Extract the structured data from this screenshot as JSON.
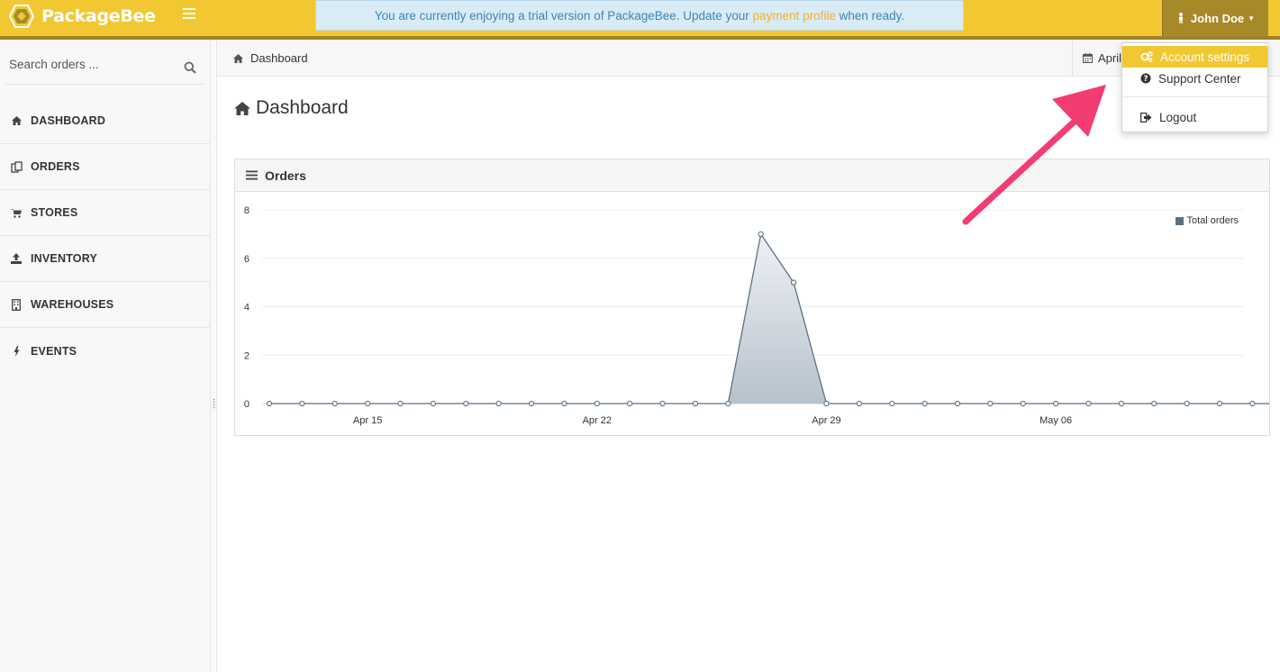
{
  "app": {
    "name": "PackageBee",
    "brand_color": "#f2c832"
  },
  "trial_banner": {
    "text_before": "You are currently enjoying a trial version of PackageBee. Update your ",
    "link": "payment profile",
    "text_after": " when ready."
  },
  "user_menu": {
    "name": "John Doe",
    "items": [
      {
        "label": "Account settings",
        "icon": "gears-icon",
        "active": true
      },
      {
        "label": "Support Center",
        "icon": "question-icon",
        "active": false
      },
      {
        "label": "Logout",
        "icon": "logout-icon",
        "active": false
      }
    ]
  },
  "sidebar": {
    "search_placeholder": "Search orders ...",
    "items": [
      {
        "label": "DASHBOARD",
        "icon": "home-icon"
      },
      {
        "label": "ORDERS",
        "icon": "copy-icon"
      },
      {
        "label": "STORES",
        "icon": "cart-icon"
      },
      {
        "label": "INVENTORY",
        "icon": "upload-icon"
      },
      {
        "label": "WAREHOUSES",
        "icon": "building-icon"
      },
      {
        "label": "EVENTS",
        "icon": "bolt-icon"
      }
    ]
  },
  "breadcrumb": {
    "label": "Dashboard",
    "date_label": "April"
  },
  "page": {
    "title": "Dashboard"
  },
  "orders_panel": {
    "title": "Orders"
  },
  "chart_data": {
    "type": "area",
    "title": "",
    "xlabel": "",
    "ylabel": "",
    "ylim": [
      0,
      8
    ],
    "yticks": [
      0,
      2,
      4,
      6,
      8
    ],
    "x_start": "Apr 12",
    "x_end": "May 13",
    "xtick_labels": [
      "Apr 15",
      "Apr 22",
      "Apr 29",
      "May 06"
    ],
    "grid": true,
    "legend_position": "top-right",
    "series": [
      {
        "name": "Total orders",
        "color": "#5b7085",
        "x": [
          "Apr 12",
          "Apr 13",
          "Apr 14",
          "Apr 15",
          "Apr 16",
          "Apr 17",
          "Apr 18",
          "Apr 19",
          "Apr 20",
          "Apr 21",
          "Apr 22",
          "Apr 23",
          "Apr 24",
          "Apr 25",
          "Apr 26",
          "Apr 27",
          "Apr 28",
          "Apr 29",
          "Apr 30",
          "May 01",
          "May 02",
          "May 03",
          "May 04",
          "May 05",
          "May 06",
          "May 07",
          "May 08",
          "May 09",
          "May 10",
          "May 11",
          "May 12",
          "May 13"
        ],
        "values": [
          0,
          0,
          0,
          0,
          0,
          0,
          0,
          0,
          0,
          0,
          0,
          0,
          0,
          0,
          0,
          7,
          5,
          0,
          0,
          0,
          0,
          0,
          0,
          0,
          0,
          0,
          0,
          0,
          0,
          0,
          0,
          0
        ]
      }
    ]
  }
}
